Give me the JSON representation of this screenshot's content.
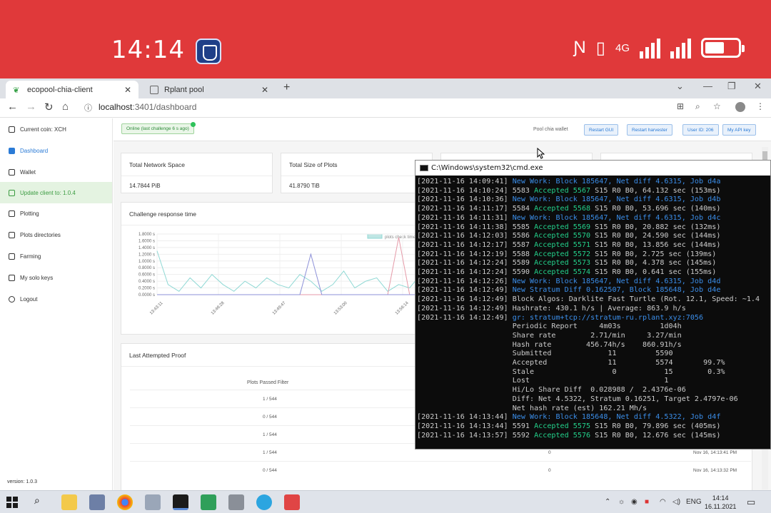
{
  "phone_status": {
    "time": "14:14",
    "network": "4G"
  },
  "browser": {
    "tabs": [
      {
        "label": "ecopool-chia-client",
        "active": true
      },
      {
        "label": "Rplant pool",
        "active": false
      }
    ],
    "new_tab": "+",
    "url_host": "localhost",
    "url_path": ":3401/dashboard"
  },
  "sidebar": {
    "items": [
      {
        "label": "Current coin: XCH",
        "icon": "coin-icon"
      },
      {
        "label": "Dashboard",
        "icon": "dashboard-icon"
      },
      {
        "label": "Wallet",
        "icon": "wallet-icon"
      },
      {
        "label": "Update client to: 1.0.4",
        "icon": "download-icon"
      },
      {
        "label": "Plotting",
        "icon": "plot-icon"
      },
      {
        "label": "Plots directories",
        "icon": "folder-icon"
      },
      {
        "label": "Farming",
        "icon": "farming-icon"
      },
      {
        "label": "My solo keys",
        "icon": "key-icon"
      },
      {
        "label": "Logout",
        "icon": "user-icon"
      }
    ],
    "version": "version: 1.0.3"
  },
  "topbar": {
    "online": "Online (last challenge 6 s ago)",
    "pool_link": "Pool chia wallet",
    "buttons": [
      "Restart GUI",
      "Restart harvester",
      "User ID: 206",
      "My API key"
    ]
  },
  "stats": [
    {
      "label": "Total Network Space",
      "value": "14.7844 PiB"
    },
    {
      "label": "Total Size of Plots",
      "value": "41.8790 TiB"
    }
  ],
  "chart_title": "Challenge response time",
  "chart_data": {
    "type": "line",
    "title": "Challenge response time",
    "legend": [
      "plots check time"
    ],
    "yticks": [
      "1.8000 s",
      "1.6000 s",
      "1.4000 s",
      "1.2000 s",
      "1.0000 s",
      "0.8000 s",
      "0.6000 s",
      "0.4000 s",
      "0.2000 s",
      "0.0000 s"
    ],
    "xticks": [
      "13:43:11",
      "13:46:28",
      "13:49:47",
      "13:53:00",
      "13:56:14"
    ],
    "ylim": [
      0,
      1.8
    ],
    "series": [
      {
        "name": "plots check time",
        "color": "#8fd8d4",
        "values": [
          1.3,
          0.3,
          0.1,
          0.5,
          0.2,
          0.6,
          0.3,
          0.1,
          0.4,
          0.2,
          0.5,
          0.3,
          0.2,
          0.6,
          0.4,
          0.1,
          0.3,
          0.7,
          0.2,
          0.4,
          0.5,
          0.1,
          0.3,
          0.2,
          0.6,
          0.2,
          0.4,
          0.3,
          0.1,
          0.5,
          0.2,
          0.3,
          0.4,
          0.1,
          0.6,
          0.3,
          0.2,
          0.4,
          0.5,
          0.2
        ]
      },
      {
        "color": "#e59aa8",
        "values": [
          0,
          0,
          0,
          0,
          0,
          0,
          0,
          0,
          0,
          0,
          0,
          0,
          0,
          0,
          0,
          0,
          0,
          0,
          0,
          0,
          0,
          0,
          1.7,
          0,
          0,
          0,
          0,
          0,
          0,
          0,
          0,
          1.7,
          0,
          0,
          0,
          0,
          0,
          0,
          0,
          0
        ]
      },
      {
        "color": "#8c90d8",
        "values": [
          0,
          0,
          0,
          0,
          0,
          0,
          0,
          0,
          0,
          0,
          0,
          0,
          0,
          0,
          1.2,
          0,
          0,
          0,
          0,
          0,
          0,
          0,
          0,
          0,
          0,
          0,
          0,
          0,
          0,
          0,
          0,
          0,
          0,
          0,
          0,
          0,
          1.5,
          0,
          0,
          0
        ]
      }
    ]
  },
  "proof": {
    "title": "Last Attempted Proof",
    "column": "Plots Passed Filter",
    "rows": [
      {
        "filter": "1 / 544",
        "proofs": "",
        "time": ""
      },
      {
        "filter": "0 / 544",
        "proofs": "",
        "time": ""
      },
      {
        "filter": "1 / 544",
        "proofs": "",
        "time": ""
      },
      {
        "filter": "1 / 544",
        "proofs": "0",
        "time": "Nov 16, 14:13:41 PM"
      },
      {
        "filter": "0 / 544",
        "proofs": "0",
        "time": "Nov 16, 14:13:32 PM"
      }
    ]
  },
  "cmd": {
    "title": "C:\\Windows\\system32\\cmd.exe",
    "lines": [
      {
        "ts": "[2021-11-16 14:09:41]",
        "segs": [
          {
            "t": "New Work: Block 185647, Net diff 4.6315, Job d4a",
            "c": "blue"
          }
        ]
      },
      {
        "ts": "[2021-11-16 14:10:24]",
        "segs": [
          {
            "t": "5583 ",
            "c": "white"
          },
          {
            "t": "Accepted 5567",
            "c": "green"
          },
          {
            "t": " S15 R0 B0, 64.132 sec (153ms)",
            "c": "white"
          }
        ]
      },
      {
        "ts": "[2021-11-16 14:10:36]",
        "segs": [
          {
            "t": "New Work: Block 185647, Net diff 4.6315, Job d4b",
            "c": "blue"
          }
        ]
      },
      {
        "ts": "[2021-11-16 14:11:17]",
        "segs": [
          {
            "t": "5584 ",
            "c": "white"
          },
          {
            "t": "Accepted 5568",
            "c": "green"
          },
          {
            "t": " S15 R0 B0, 53.696 sec (140ms)",
            "c": "white"
          }
        ]
      },
      {
        "ts": "[2021-11-16 14:11:31]",
        "segs": [
          {
            "t": "New Work: Block 185647, Net diff 4.6315, Job d4c",
            "c": "blue"
          }
        ]
      },
      {
        "ts": "[2021-11-16 14:11:38]",
        "segs": [
          {
            "t": "5585 ",
            "c": "white"
          },
          {
            "t": "Accepted 5569",
            "c": "green"
          },
          {
            "t": " S15 R0 B0, 20.882 sec (132ms)",
            "c": "white"
          }
        ]
      },
      {
        "ts": "[2021-11-16 14:12:03]",
        "segs": [
          {
            "t": "5586 ",
            "c": "white"
          },
          {
            "t": "Accepted 5570",
            "c": "green"
          },
          {
            "t": " S15 R0 B0, 24.590 sec (144ms)",
            "c": "white"
          }
        ]
      },
      {
        "ts": "[2021-11-16 14:12:17]",
        "segs": [
          {
            "t": "5587 ",
            "c": "white"
          },
          {
            "t": "Accepted 5571",
            "c": "green"
          },
          {
            "t": " S15 R0 B0, 13.856 sec (144ms)",
            "c": "white"
          }
        ]
      },
      {
        "ts": "[2021-11-16 14:12:19]",
        "segs": [
          {
            "t": "5588 ",
            "c": "white"
          },
          {
            "t": "Accepted 5572",
            "c": "green"
          },
          {
            "t": " S15 R0 B0, 2.725 sec (139ms)",
            "c": "white"
          }
        ]
      },
      {
        "ts": "[2021-11-16 14:12:24]",
        "segs": [
          {
            "t": "5589 ",
            "c": "white"
          },
          {
            "t": "Accepted 5573",
            "c": "green"
          },
          {
            "t": " S15 R0 B0, 4.378 sec (145ms)",
            "c": "white"
          }
        ]
      },
      {
        "ts": "[2021-11-16 14:12:24]",
        "segs": [
          {
            "t": "5590 ",
            "c": "white"
          },
          {
            "t": "Accepted 5574",
            "c": "green"
          },
          {
            "t": " S15 R0 B0, 0.641 sec (155ms)",
            "c": "white"
          }
        ]
      },
      {
        "ts": "[2021-11-16 14:12:26]",
        "segs": [
          {
            "t": "New Work: Block 185647, Net diff 4.6315, Job d4d",
            "c": "blue"
          }
        ]
      },
      {
        "ts": "[2021-11-16 14:12:49]",
        "segs": [
          {
            "t": "New Stratum Diff 0.162507, Block 185648, Job d4e",
            "c": "blue"
          }
        ]
      },
      {
        "ts": "[2021-11-16 14:12:49]",
        "segs": [
          {
            "t": "Block Algos: Darklite Fast Turtle (Rot. 12.1, Speed: ~1.4",
            "c": "white"
          }
        ]
      },
      {
        "ts": "[2021-11-16 14:12:49]",
        "segs": [
          {
            "t": "Hashrate: 430.1 h/s | Average: 863.9 h/s",
            "c": "white"
          }
        ]
      },
      {
        "ts": "[2021-11-16 14:12:49]",
        "segs": [
          {
            "t": "gr: stratum+tcp://stratum-ru.rplant.xyz:7056",
            "c": "blue"
          }
        ]
      },
      {
        "ts": "                     ",
        "segs": [
          {
            "t": "Periodic Report     4m03s         1d04h",
            "c": "white"
          }
        ]
      },
      {
        "ts": "                     ",
        "segs": [
          {
            "t": "Share rate        2.71/min     3.27/min",
            "c": "white"
          }
        ]
      },
      {
        "ts": "                     ",
        "segs": [
          {
            "t": "Hash rate        456.74h/s    860.91h/s",
            "c": "white"
          }
        ]
      },
      {
        "ts": "                     ",
        "segs": [
          {
            "t": "Submitted             11         5590",
            "c": "white"
          }
        ]
      },
      {
        "ts": "                     ",
        "segs": [
          {
            "t": "Accepted              11         5574       99.7%",
            "c": "white"
          }
        ]
      },
      {
        "ts": "                     ",
        "segs": [
          {
            "t": "Stale                  0           15        0.3%",
            "c": "white"
          }
        ]
      },
      {
        "ts": "                     ",
        "segs": [
          {
            "t": "Lost                               1",
            "c": "white"
          }
        ]
      },
      {
        "ts": "                     ",
        "segs": [
          {
            "t": "Hi/Lo Share Diff  0.028988 /  2.4376e-06",
            "c": "white"
          }
        ]
      },
      {
        "ts": "                     ",
        "segs": [
          {
            "t": "Diff: Net 4.5322, Stratum 0.16251, Target 2.4797e-06",
            "c": "white"
          }
        ]
      },
      {
        "ts": "                     ",
        "segs": [
          {
            "t": "Net hash rate (est) 162.21 Mh/s",
            "c": "white"
          }
        ]
      },
      {
        "ts": "[2021-11-16 14:13:44]",
        "segs": [
          {
            "t": "New Work: Block 185648, Net diff 4.5322, Job d4f",
            "c": "blue"
          }
        ]
      },
      {
        "ts": "[2021-11-16 14:13:44]",
        "segs": [
          {
            "t": "5591 ",
            "c": "white"
          },
          {
            "t": "Accepted 5575",
            "c": "green"
          },
          {
            "t": " S15 R0 B0, 79.896 sec (405ms)",
            "c": "white"
          }
        ]
      },
      {
        "ts": "[2021-11-16 14:13:57]",
        "segs": [
          {
            "t": "5592 ",
            "c": "white"
          },
          {
            "t": "Accepted 5576",
            "c": "green"
          },
          {
            "t": " S15 R0 B0, 12.676 sec (145ms)",
            "c": "white"
          }
        ]
      }
    ]
  },
  "taskbar": {
    "language": "ENG",
    "time": "14:14",
    "date": "16.11.2021"
  },
  "colors": {
    "status_bar": "#e0393a",
    "accent": "#2b7bd6",
    "online": "#2e8b3a",
    "console_bg": "#0c0c0c"
  }
}
